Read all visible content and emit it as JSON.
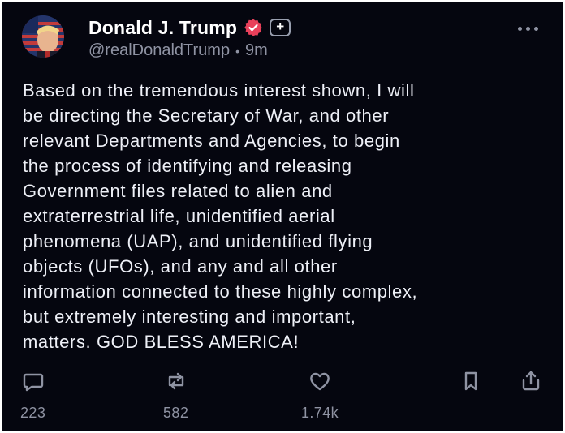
{
  "post": {
    "author_name": "Donald J. Trump",
    "handle": "@realDonaldTrump",
    "separator": "•",
    "time_ago": "9m",
    "plus_label": "+",
    "text": "Based on the tremendous interest shown, I will\nbe directing the Secretary of War, and other\nrelevant Departments and Agencies, to begin\nthe process of identifying and releasing\nGovernment files related to alien and\nextraterrestrial life, unidentified aerial\nphenomena (UAP), and unidentified flying\nobjects (UFOs), and any and all other\ninformation connected to these highly complex,\nbut extremely interesting and important,\nmatters. GOD BLESS AMERICA!"
  },
  "actions": {
    "replies": "223",
    "reposts": "582",
    "likes": "1.74k"
  },
  "icons": {
    "reply": "reply-icon",
    "repost": "repost-icon",
    "like": "heart-icon",
    "bookmark": "bookmark-icon",
    "share": "share-icon",
    "more": "more-icon",
    "verified": "verified-badge-icon"
  },
  "colors": {
    "background": "#05060f",
    "text": "#eef0f7",
    "muted": "#8f93a3",
    "verified_badge": "#e8405a"
  }
}
